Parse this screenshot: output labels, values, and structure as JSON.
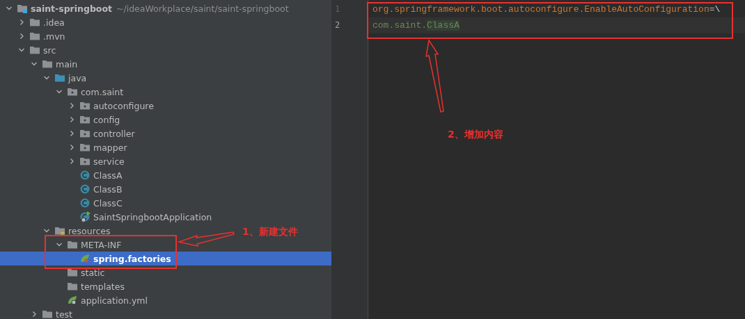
{
  "project_tree": {
    "items": [
      {
        "name": "saint-springboot",
        "path": "~/ideaWorkplace/saint/saint-springboot",
        "kind": "module",
        "expanded": true,
        "selected": false,
        "children": [
          {
            "name": ".idea",
            "kind": "folder",
            "expanded": false,
            "selected": false
          },
          {
            "name": ".mvn",
            "kind": "folder",
            "expanded": false,
            "selected": false
          },
          {
            "name": "src",
            "kind": "folder",
            "expanded": true,
            "selected": false,
            "children": [
              {
                "name": "main",
                "kind": "folder",
                "expanded": true,
                "selected": false,
                "children": [
                  {
                    "name": "java",
                    "kind": "source",
                    "expanded": true,
                    "selected": false,
                    "children": [
                      {
                        "name": "com.saint",
                        "kind": "package",
                        "expanded": true,
                        "selected": false,
                        "children": [
                          {
                            "name": "autoconfigure",
                            "kind": "package",
                            "expanded": false,
                            "selected": false
                          },
                          {
                            "name": "config",
                            "kind": "package",
                            "expanded": false,
                            "selected": false
                          },
                          {
                            "name": "controller",
                            "kind": "package",
                            "expanded": false,
                            "selected": false
                          },
                          {
                            "name": "mapper",
                            "kind": "package",
                            "expanded": false,
                            "selected": false
                          },
                          {
                            "name": "service",
                            "kind": "package",
                            "expanded": false,
                            "selected": false
                          },
                          {
                            "name": "ClassA",
                            "kind": "class",
                            "selected": false
                          },
                          {
                            "name": "ClassB",
                            "kind": "class",
                            "selected": false
                          },
                          {
                            "name": "ClassC",
                            "kind": "class",
                            "selected": false
                          },
                          {
                            "name": "SaintSpringbootApplication",
                            "kind": "app",
                            "selected": false
                          }
                        ]
                      }
                    ]
                  },
                  {
                    "name": "resources",
                    "kind": "resources",
                    "expanded": true,
                    "selected": false,
                    "children": [
                      {
                        "name": "META-INF",
                        "kind": "folder",
                        "expanded": true,
                        "selected": false,
                        "children": [
                          {
                            "name": "spring.factories",
                            "kind": "spring",
                            "selected": true
                          }
                        ]
                      },
                      {
                        "name": "static",
                        "kind": "folder",
                        "selected": false
                      },
                      {
                        "name": "templates",
                        "kind": "folder",
                        "selected": false
                      },
                      {
                        "name": "application.yml",
                        "kind": "config",
                        "selected": false
                      }
                    ]
                  }
                ]
              },
              {
                "name": "test",
                "kind": "folder",
                "expanded": false,
                "selected": false
              }
            ]
          }
        ]
      }
    ]
  },
  "editor": {
    "lines": [
      {
        "number": "1",
        "current": false,
        "tokens": [
          {
            "text": "org.springframework.boot.autoconfigure.EnableAutoConfiguration",
            "kind": "key"
          },
          {
            "text": "=",
            "kind": "separator"
          },
          {
            "text": "\\",
            "kind": "escape"
          }
        ]
      },
      {
        "number": "2",
        "current": true,
        "tokens": [
          {
            "text": "com.saint.",
            "kind": "value"
          },
          {
            "text": "ClassA",
            "kind": "match"
          }
        ]
      }
    ]
  },
  "annotations": [
    {
      "text": "1、新建文件"
    },
    {
      "text": "2、增加内容"
    }
  ]
}
